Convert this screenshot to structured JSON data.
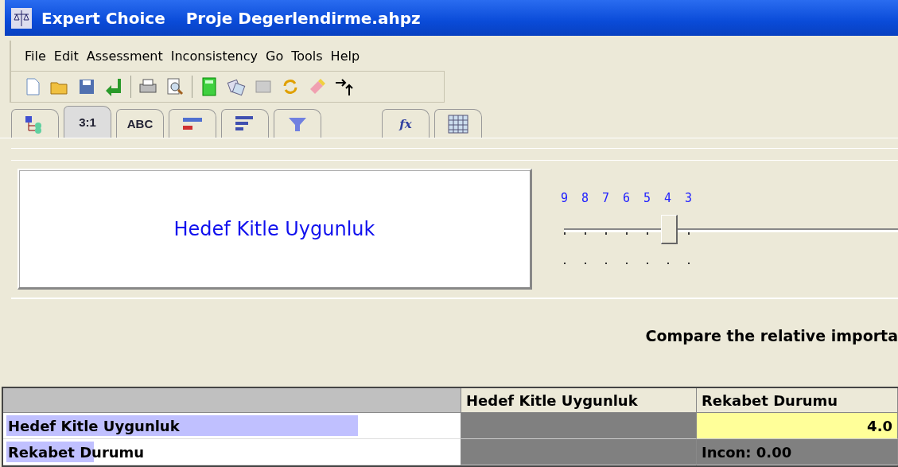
{
  "window": {
    "title": "Expert Choice",
    "document": "Proje Degerlendirme.ahpz"
  },
  "menu": [
    {
      "label": "File"
    },
    {
      "label": "Edit"
    },
    {
      "label": "Assessment"
    },
    {
      "label": "Inconsistency"
    },
    {
      "label": "Go"
    },
    {
      "label": "Tools"
    },
    {
      "label": "Help"
    }
  ],
  "toolbar": [
    {
      "kind": "new"
    },
    {
      "kind": "open"
    },
    {
      "kind": "save"
    },
    {
      "kind": "enter"
    },
    {
      "kind": "sep"
    },
    {
      "kind": "print"
    },
    {
      "kind": "preview"
    },
    {
      "kind": "sep"
    },
    {
      "kind": "calculator"
    },
    {
      "kind": "swap"
    },
    {
      "kind": "disabled"
    },
    {
      "kind": "refresh"
    },
    {
      "kind": "eraser"
    },
    {
      "kind": "arrows"
    }
  ],
  "tabs": [
    {
      "kind": "tree",
      "selected": false
    },
    {
      "kind": "text",
      "label": "3:1",
      "selected": true
    },
    {
      "kind": "text",
      "label": "ABC",
      "selected": false
    },
    {
      "kind": "bars2",
      "selected": false
    },
    {
      "kind": "bars3",
      "selected": false
    },
    {
      "kind": "funnel",
      "selected": false
    },
    {
      "kind": "gap"
    },
    {
      "kind": "text",
      "label": "fx",
      "selected": false
    },
    {
      "kind": "grid",
      "selected": false
    }
  ],
  "comparison": {
    "element": "Hedef Kitle Uygunluk",
    "scale": [
      "9",
      "8",
      "7",
      "6",
      "5",
      "4",
      "3"
    ],
    "slider": {
      "level": 0.3125
    }
  },
  "instruction": "Compare the relative importa",
  "matrix": {
    "columns": [
      "Hedef Kitle Uygunluk",
      "Rekabet Durumu"
    ],
    "rows": [
      {
        "name": "Hedef Kitle Uygunluk",
        "level": 0.8,
        "cells": [
          {
            "kind": "diagonal"
          },
          {
            "kind": "value",
            "text": "4.0"
          }
        ]
      },
      {
        "name": "Rekabet Durumu",
        "level": 0.2,
        "cells": [
          {
            "kind": "dark"
          },
          {
            "kind": "diagonal",
            "text": "Incon: 0.00"
          }
        ]
      }
    ]
  }
}
